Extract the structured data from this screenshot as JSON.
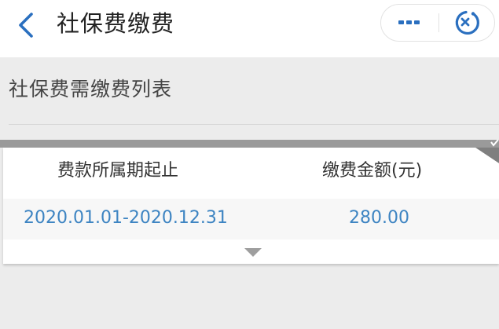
{
  "navbar": {
    "title": "社保费缴费",
    "back_icon": "chevron-left-icon",
    "more_icon": "more-dots-icon",
    "close_icon": "mini-program-close-icon",
    "accent_color": "#2a6fbf"
  },
  "section": {
    "title": "社保费需缴费列表"
  },
  "table": {
    "headers": {
      "period": "费款所属期起止",
      "amount": "缴费金额(元)"
    },
    "rows": [
      {
        "period": "2020.01.01-2020.12.31",
        "amount": "280.00"
      }
    ],
    "value_color": "#3d84c2",
    "expand_icon": "caret-down-icon"
  }
}
